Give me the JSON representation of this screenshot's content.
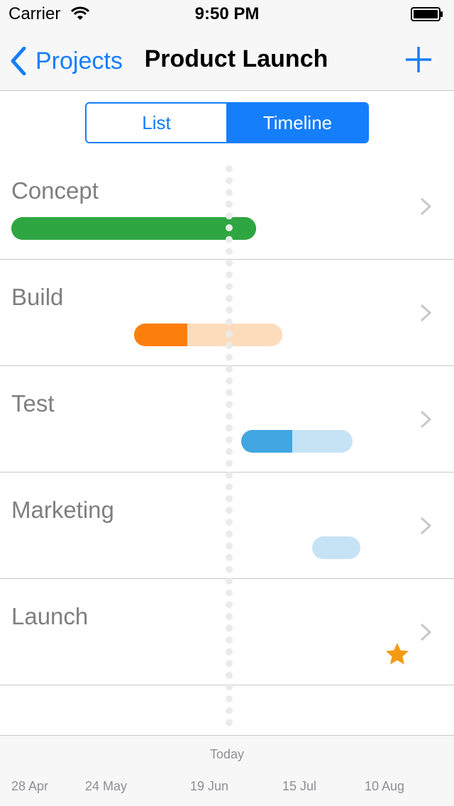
{
  "status_bar": {
    "carrier": "Carrier",
    "time": "9:50 PM"
  },
  "nav": {
    "back_label": "Projects",
    "title": "Product Launch",
    "add_icon": "plus-icon"
  },
  "segmented": {
    "options": [
      "List",
      "Timeline"
    ],
    "selected": "Timeline"
  },
  "colors": {
    "accent": "#157efb",
    "concept": "#2ea641",
    "build_done": "#fc7f0d",
    "build_remaining": "#fddcbc",
    "test_done": "#41a6e2",
    "test_remaining": "#c6e3f6",
    "marketing": "#c6e3f6",
    "milestone": "#f39c12"
  },
  "phases": [
    {
      "name": "Concept",
      "progress": 1.0
    },
    {
      "name": "Build",
      "progress": 0.36
    },
    {
      "name": "Test",
      "progress": 0.46
    },
    {
      "name": "Marketing",
      "progress": 0.0
    },
    {
      "name": "Launch",
      "milestone_icon": "star-icon"
    }
  ],
  "footer": {
    "today_label": "Today",
    "dates": [
      "28 Apr",
      "24 May",
      "19 Jun",
      "15 Jul",
      "10 Aug"
    ]
  }
}
